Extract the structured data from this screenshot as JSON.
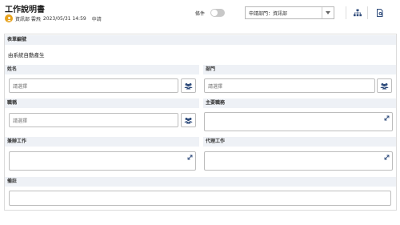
{
  "header": {
    "title": "工作說明書",
    "applicant": "資訊部 雲飛",
    "datetime": "2023/05/31 14:59",
    "status": "申請",
    "condition_label": "條件",
    "dept_select_value": "申請部門：資訊部"
  },
  "form": {
    "doc_no": {
      "label": "表單編號",
      "value": "由系統自動產生"
    },
    "name": {
      "label": "姓名",
      "placeholder": "請選擇"
    },
    "department": {
      "label": "部門",
      "placeholder": "請選擇"
    },
    "job_title": {
      "label": "職稱",
      "placeholder": "請選擇"
    },
    "main_duties": {
      "label": "主要職務",
      "value": ""
    },
    "concurrent_work": {
      "label": "兼辦工作",
      "value": ""
    },
    "proxy_work": {
      "label": "代理工作",
      "value": ""
    },
    "remarks": {
      "label": "備註",
      "value": ""
    }
  },
  "icons": {
    "avatar": "user-avatar-icon",
    "people_picker": "people-icon",
    "expand": "expand-icon",
    "org_chart": "org-chart-icon",
    "document_search": "document-search-icon",
    "dropdown": "chevron-down-icon"
  },
  "colors": {
    "avatar": "#e7a21c",
    "band": "#eef1f6",
    "toggle_off": "#c8c8c8",
    "icon": "#2d4a7a"
  }
}
